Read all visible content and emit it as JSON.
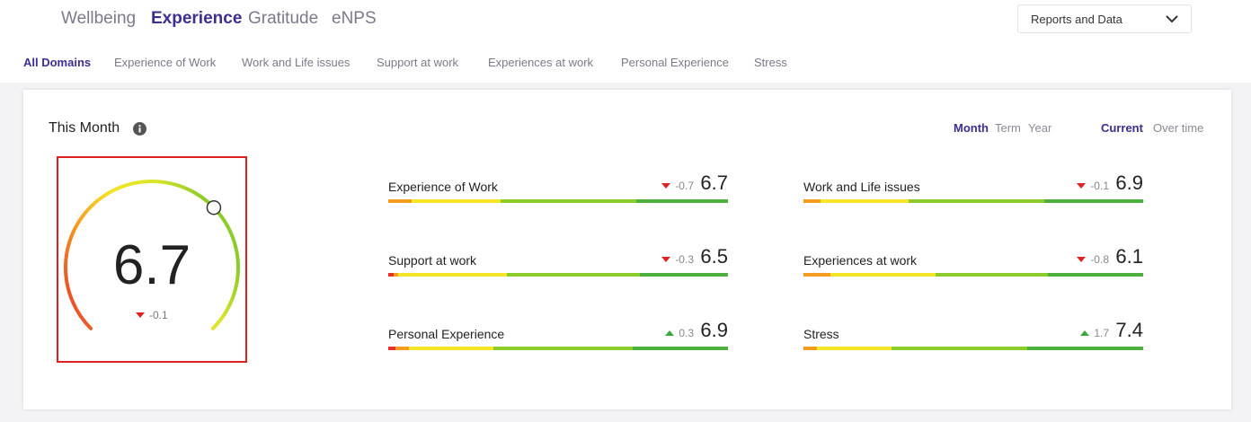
{
  "top_tabs": [
    {
      "label": "Wellbeing",
      "active": false
    },
    {
      "label": "Experience",
      "active": true
    },
    {
      "label": "Gratitude",
      "active": false
    },
    {
      "label": "eNPS",
      "active": false
    }
  ],
  "reports_dropdown": {
    "label": "Reports and Data"
  },
  "sub_tabs": [
    {
      "label": "All Domains",
      "active": true
    },
    {
      "label": "Experience of Work",
      "active": false
    },
    {
      "label": "Work and Life issues",
      "active": false
    },
    {
      "label": "Support at work",
      "active": false
    },
    {
      "label": "Experiences at work",
      "active": false
    },
    {
      "label": "Personal Experience",
      "active": false
    },
    {
      "label": "Stress",
      "active": false
    }
  ],
  "card": {
    "title": "This Month",
    "period_toggle": [
      "Month",
      "Term",
      "Year"
    ],
    "period_selected": "Month",
    "view_toggle": [
      "Current",
      "Over time"
    ],
    "view_selected": "Current"
  },
  "gauge": {
    "score": "6.7",
    "score_value": 6.7,
    "max": 10,
    "delta": "-0.1",
    "direction": "down"
  },
  "metrics": [
    {
      "name": "Experience of Work",
      "delta": "-0.7",
      "direction": "down",
      "value": "6.7",
      "bar": [
        {
          "pct": 7,
          "color": "#f39c1f"
        },
        {
          "pct": 26,
          "color": "#f4e526"
        },
        {
          "pct": 40,
          "color": "#8ccc2a"
        },
        {
          "pct": 27,
          "color": "#4caf3e"
        }
      ]
    },
    {
      "name": "Work and Life issues",
      "delta": "-0.1",
      "direction": "down",
      "value": "6.9",
      "bar": [
        {
          "pct": 5,
          "color": "#f39c1f"
        },
        {
          "pct": 26,
          "color": "#f4e526"
        },
        {
          "pct": 40,
          "color": "#8ccc2a"
        },
        {
          "pct": 29,
          "color": "#4caf3e"
        }
      ]
    },
    {
      "name": "Support at work",
      "delta": "-0.3",
      "direction": "down",
      "value": "6.5",
      "bar": [
        {
          "pct": 1.5,
          "color": "#e8312a"
        },
        {
          "pct": 1.5,
          "color": "#f39c1f"
        },
        {
          "pct": 32,
          "color": "#f4e526"
        },
        {
          "pct": 39,
          "color": "#8ccc2a"
        },
        {
          "pct": 26,
          "color": "#4caf3e"
        }
      ]
    },
    {
      "name": "Experiences at work",
      "delta": "-0.8",
      "direction": "down",
      "value": "6.1",
      "bar": [
        {
          "pct": 8,
          "color": "#f39c1f"
        },
        {
          "pct": 31,
          "color": "#f4e526"
        },
        {
          "pct": 33,
          "color": "#8ccc2a"
        },
        {
          "pct": 28,
          "color": "#4caf3e"
        }
      ]
    },
    {
      "name": "Personal Experience",
      "delta": "0.3",
      "direction": "up",
      "value": "6.9",
      "bar": [
        {
          "pct": 2,
          "color": "#e8312a"
        },
        {
          "pct": 4,
          "color": "#f39c1f"
        },
        {
          "pct": 25,
          "color": "#f4e526"
        },
        {
          "pct": 41,
          "color": "#8ccc2a"
        },
        {
          "pct": 28,
          "color": "#4caf3e"
        }
      ]
    },
    {
      "name": "Stress",
      "delta": "1.7",
      "direction": "up",
      "value": "7.4",
      "bar": [
        {
          "pct": 4,
          "color": "#f39c1f"
        },
        {
          "pct": 22,
          "color": "#f4e526"
        },
        {
          "pct": 40,
          "color": "#8ccc2a"
        },
        {
          "pct": 34,
          "color": "#4caf3e"
        }
      ]
    }
  ],
  "colors": {
    "accent": "#3d2f8f",
    "down": "#dd2222",
    "up": "#3ea640",
    "highlight": "#e0201f"
  }
}
